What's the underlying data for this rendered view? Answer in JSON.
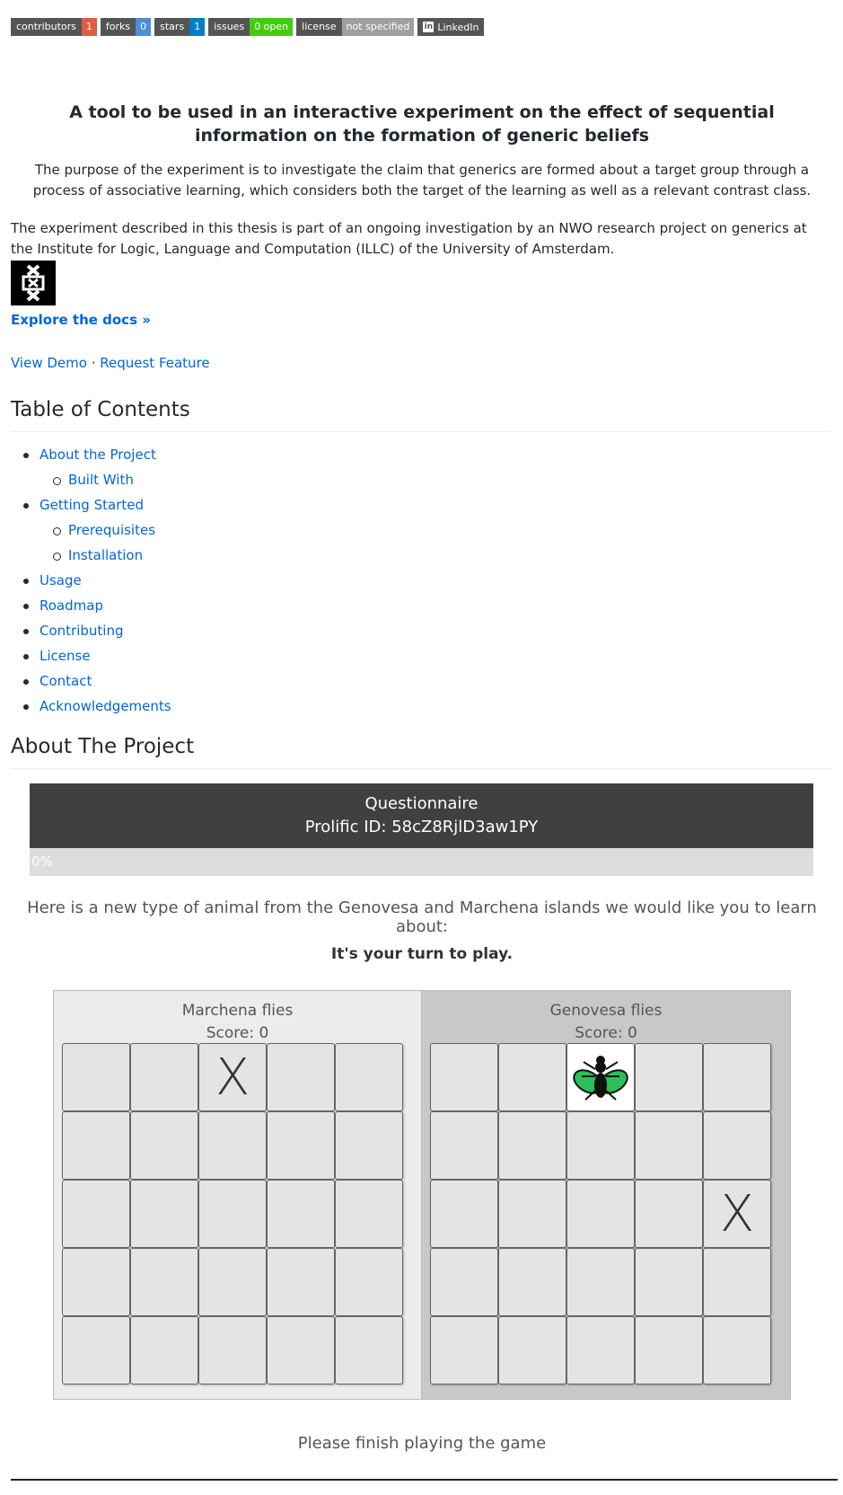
{
  "badges": [
    {
      "label": "contributors",
      "value": "1",
      "color": "#e05d44"
    },
    {
      "label": "forks",
      "value": "0",
      "color": "#4c8eda"
    },
    {
      "label": "stars",
      "value": "1",
      "color": "#007ec6"
    },
    {
      "label": "issues",
      "value": "0 open",
      "color": "#44cc11"
    },
    {
      "label": "license",
      "value": "not specified",
      "color": "#9f9f9f"
    }
  ],
  "linkedin_badge": "LinkedIn",
  "title": "A tool to be used in an interactive experiment on the effect of sequential information on the formation of generic beliefs",
  "purpose": "The purpose of the experiment is to investigate the claim that generics are formed about a target group through a process of associative learning, which considers both the target of the learning as well as a relevant contrast class.",
  "description": "The experiment described in this thesis is part of an ongoing investigation by an NWO research project on generics at the Institute for Logic, Language and Computation (ILLC) of the University of Amsterdam.",
  "explore_docs": "Explore the docs »",
  "links": {
    "view_demo": "View Demo",
    "separator": " · ",
    "request_feature": "Request Feature"
  },
  "toc_heading": "Table of Contents",
  "toc": [
    {
      "label": "About the Project",
      "level": 1
    },
    {
      "label": "Built With",
      "level": 2
    },
    {
      "label": "Getting Started",
      "level": 1
    },
    {
      "label": "Prerequisites",
      "level": 2
    },
    {
      "label": "Installation",
      "level": 2
    },
    {
      "label": "Usage",
      "level": 1
    },
    {
      "label": "Roadmap",
      "level": 1
    },
    {
      "label": "Contributing",
      "level": 1
    },
    {
      "label": "License",
      "level": 1
    },
    {
      "label": "Contact",
      "level": 1
    },
    {
      "label": "Acknowledgements",
      "level": 1
    }
  ],
  "about_heading": "About The Project",
  "questionnaire": {
    "title": "Questionnaire",
    "prolific_id": "Prolific ID: 58cZ8RjlD3aw1PY",
    "progress_label": "0%",
    "progress": 0
  },
  "intro": "Here is a new type of animal from the Genovesa and Marchena islands we would like you to learn about:",
  "turn": "It's your turn to play.",
  "boards": [
    {
      "name": "Marchena flies",
      "score": "Score: 0",
      "marks": [
        {
          "row": 0,
          "col": 2,
          "mark": "X"
        }
      ]
    },
    {
      "name": "Genovesa flies",
      "score": "Score: 0",
      "marks": [
        {
          "row": 0,
          "col": 2,
          "mark": "fly"
        },
        {
          "row": 2,
          "col": 4,
          "mark": "X"
        }
      ]
    }
  ],
  "finish": "Please finish playing the game"
}
